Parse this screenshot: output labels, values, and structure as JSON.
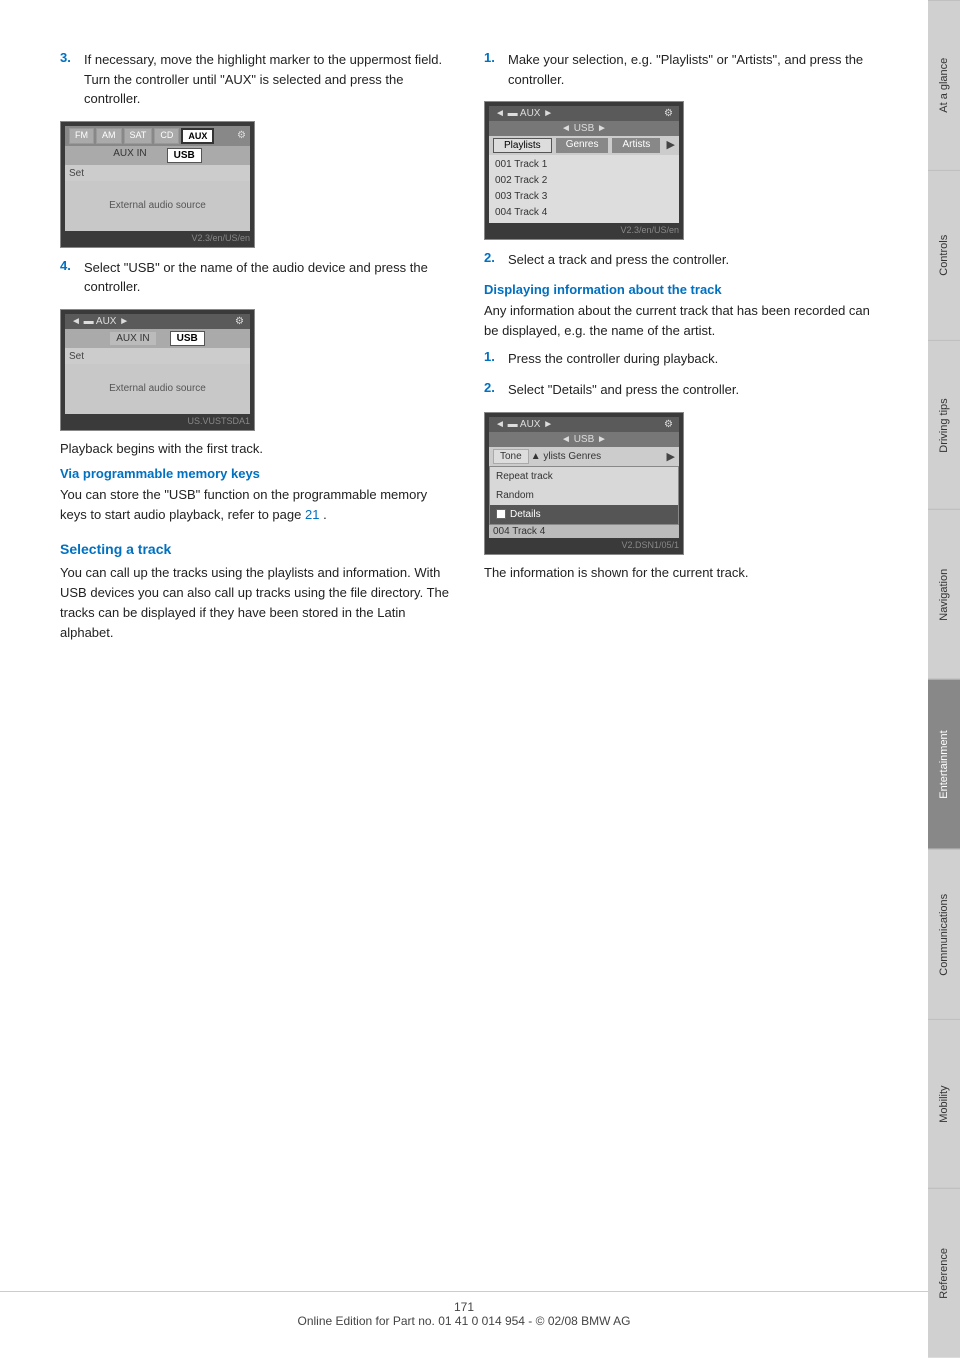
{
  "sidebar": {
    "tabs": [
      {
        "label": "At a glance",
        "active": false
      },
      {
        "label": "Controls",
        "active": false
      },
      {
        "label": "Driving tips",
        "active": false
      },
      {
        "label": "Navigation",
        "active": false
      },
      {
        "label": "Entertainment",
        "active": true
      },
      {
        "label": "Communications",
        "active": false
      },
      {
        "label": "Mobility",
        "active": false
      },
      {
        "label": "Reference",
        "active": false
      }
    ]
  },
  "left_col": {
    "step3": {
      "num": "3.",
      "text": "If necessary, move the highlight marker to the uppermost field. Turn the controller until \"AUX\" is selected and press the controller."
    },
    "screen1": {
      "radio_buttons": [
        "FM",
        "AM",
        "SAT",
        "CD",
        "AUX"
      ],
      "active_radio": "AUX",
      "row1": "AUX IN    USB",
      "label": "Set",
      "content": "External audio source",
      "caption": "V2.3/en/US/en"
    },
    "step4": {
      "num": "4.",
      "text": "Select \"USB\" or the name of the audio device and press the controller."
    },
    "screen2": {
      "topbar": "◄ ▬ AUX ►",
      "topbar_icon": "⚙",
      "row1_left": "AUX IN",
      "row1_right": "USB",
      "label": "Set",
      "content": "External audio source",
      "caption": "US.VUSTSDA1"
    },
    "playback_note": "Playback begins with the first track.",
    "via_heading": "Via programmable memory keys",
    "via_text": "You can store the \"USB\" function on the programmable memory keys to start audio playback, refer to page",
    "via_link": "21",
    "via_text2": ".",
    "selecting_heading": "Selecting a track",
    "selecting_text": "You can call up the tracks using the playlists and information. With USB devices you can also call up tracks using the file directory. The tracks can be displayed if they have been stored in the Latin alphabet."
  },
  "right_col": {
    "step1": {
      "num": "1.",
      "text": "Make your selection, e.g. \"Playlists\" or \"Artists\", and press the controller."
    },
    "screen3": {
      "topbar": "◄ ▬ AUX ►",
      "topbar_icon": "⚙",
      "usb_row": "◄ USB ►",
      "nav_tabs": [
        "Playlists",
        "Genres",
        "Artists"
      ],
      "active_tab": "Playlists",
      "tracks": [
        "001 Track 1",
        "002 Track 2",
        "003 Track 3",
        "004 Track 4"
      ],
      "caption": "V2.3/en/US/en"
    },
    "step2": {
      "num": "2.",
      "text": "Select a track and press the controller."
    },
    "displaying_heading": "Displaying information about the track",
    "displaying_text": "Any information about the current track that has been recorded can be displayed, e.g. the name of the artist.",
    "step3_r": {
      "num": "1.",
      "text": "Press the controller during playback."
    },
    "step4_r": {
      "num": "2.",
      "text": "Select \"Details\" and press the controller."
    },
    "screen4": {
      "topbar": "◄ ▬ AUX ►",
      "topbar_icon": "⚙",
      "usb_row": "◄ USB ►",
      "nav_partial": "Tone",
      "nav_right": "ylists  Genres",
      "menu_items": [
        "Repeat track",
        "Random"
      ],
      "details_item": "Details",
      "bottom_track": "004 Track 4",
      "caption": "V2.DSN1/05/1"
    },
    "info_text": "The information is shown for the current track."
  },
  "footer": {
    "page_num": "171",
    "copyright": "Online Edition for Part no. 01 41 0 014 954  - © 02/08 BMW AG"
  }
}
